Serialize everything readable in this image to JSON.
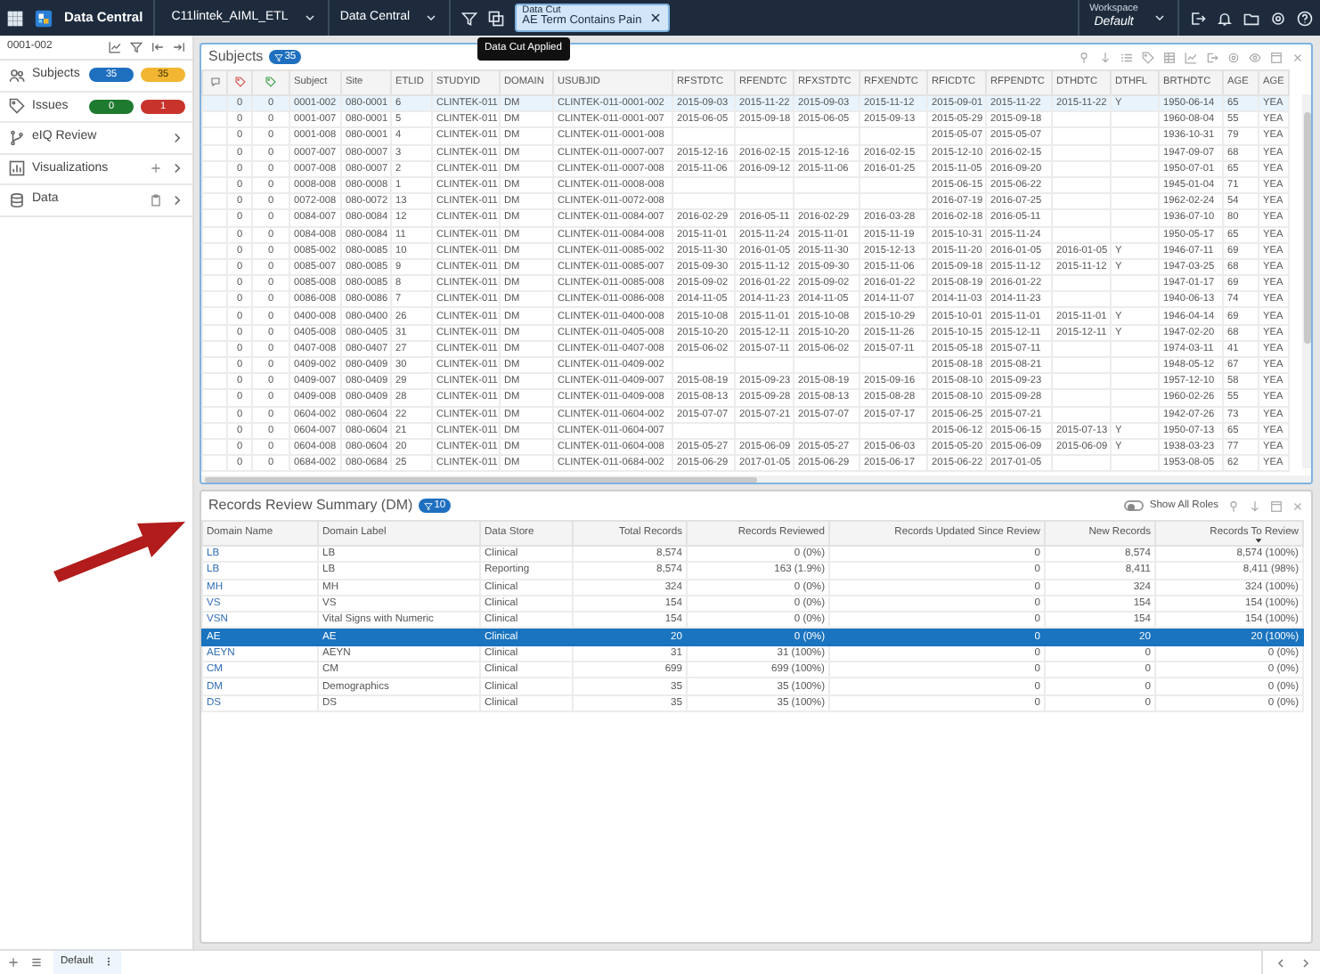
{
  "topbar": {
    "app_title": "Data Central",
    "study": "C11lintek_AIML_ETL",
    "view": "Data Central",
    "data_cut": {
      "label": "Data Cut",
      "value": "AE Term Contains Pain",
      "tooltip": "Data Cut Applied"
    },
    "workspace": {
      "label": "Workspace",
      "value": "Default"
    }
  },
  "sidebar": {
    "subject_id": "0001-002",
    "items": [
      {
        "kind": "counts",
        "label": "Subjects",
        "badges": [
          {
            "text": "35",
            "color": "#1f6fbf"
          },
          {
            "text": "35",
            "color": "#f2b632"
          }
        ]
      },
      {
        "kind": "counts",
        "label": "Issues",
        "badges": [
          {
            "text": "0",
            "color": "#1e7a2e"
          },
          {
            "text": "1",
            "color": "#c8342b"
          }
        ]
      },
      {
        "kind": "nav",
        "label": "eIQ Review"
      },
      {
        "kind": "add",
        "label": "Visualizations"
      },
      {
        "kind": "delete",
        "label": "Data"
      }
    ]
  },
  "subjects": {
    "title": "Subjects",
    "filter_count": "35",
    "columns": [
      {
        "kind": "icon"
      },
      {
        "kind": "icon"
      },
      {
        "kind": "icon"
      },
      {
        "kind": "text",
        "label": "Subject"
      },
      {
        "kind": "text",
        "label": "Site"
      },
      {
        "kind": "text",
        "label": "ETLID"
      },
      {
        "kind": "text",
        "label": "STUDYID"
      },
      {
        "kind": "text",
        "label": "DOMAIN"
      },
      {
        "kind": "text",
        "label": "USUBJID"
      },
      {
        "kind": "text",
        "label": "RFSTDTC"
      },
      {
        "kind": "text",
        "label": "RFENDTC"
      },
      {
        "kind": "text",
        "label": "RFXSTDTC"
      },
      {
        "kind": "text",
        "label": "RFXENDTC"
      },
      {
        "kind": "text",
        "label": "RFICDTC"
      },
      {
        "kind": "text",
        "label": "RFPENDTC"
      },
      {
        "kind": "text",
        "label": "DTHDTC"
      },
      {
        "kind": "text",
        "label": "DTHFL"
      },
      {
        "kind": "text",
        "label": "BRTHDTC"
      },
      {
        "kind": "text",
        "label": "AGE"
      },
      {
        "kind": "text",
        "label": "AGE"
      }
    ],
    "rows": [
      {
        "selected": true,
        "cells": [
          null,
          "0",
          "0",
          "0001-002",
          "080-0001",
          "6",
          "CLINTEK-011",
          "DM",
          "CLINTEK-011-0001-002",
          "2015-09-03",
          "2015-11-22",
          "2015-09-03",
          "2015-11-12",
          "2015-09-01",
          "2015-11-22",
          "2015-11-22",
          "Y",
          "1950-06-14",
          "65",
          "YEA"
        ]
      },
      {
        "selected": false,
        "cells": [
          null,
          "0",
          "0",
          "0001-007",
          "080-0001",
          "5",
          "CLINTEK-011",
          "DM",
          "CLINTEK-011-0001-007",
          "2015-06-05",
          "2015-09-18",
          "2015-06-05",
          "2015-09-13",
          "2015-05-29",
          "2015-09-18",
          null,
          null,
          "1960-08-04",
          "55",
          "YEA"
        ]
      },
      {
        "selected": false,
        "cells": [
          null,
          "0",
          "0",
          "0001-008",
          "080-0001",
          "4",
          "CLINTEK-011",
          "DM",
          "CLINTEK-011-0001-008",
          null,
          null,
          null,
          null,
          "2015-05-07",
          "2015-05-07",
          null,
          null,
          "1936-10-31",
          "79",
          "YEA"
        ]
      },
      {
        "selected": false,
        "cells": [
          null,
          "0",
          "0",
          "0007-007",
          "080-0007",
          "3",
          "CLINTEK-011",
          "DM",
          "CLINTEK-011-0007-007",
          "2015-12-16",
          "2016-02-15",
          "2015-12-16",
          "2016-02-15",
          "2015-12-10",
          "2016-02-15",
          null,
          null,
          "1947-09-07",
          "68",
          "YEA"
        ]
      },
      {
        "selected": false,
        "cells": [
          null,
          "0",
          "0",
          "0007-008",
          "080-0007",
          "2",
          "CLINTEK-011",
          "DM",
          "CLINTEK-011-0007-008",
          "2015-11-06",
          "2016-09-12",
          "2015-11-06",
          "2016-01-25",
          "2015-11-05",
          "2016-09-20",
          null,
          null,
          "1950-07-01",
          "65",
          "YEA"
        ]
      },
      {
        "selected": false,
        "cells": [
          null,
          "0",
          "0",
          "0008-008",
          "080-0008",
          "1",
          "CLINTEK-011",
          "DM",
          "CLINTEK-011-0008-008",
          null,
          null,
          null,
          null,
          "2015-06-15",
          "2015-06-22",
          null,
          null,
          "1945-01-04",
          "71",
          "YEA"
        ]
      },
      {
        "selected": false,
        "cells": [
          null,
          "0",
          "0",
          "0072-008",
          "080-0072",
          "13",
          "CLINTEK-011",
          "DM",
          "CLINTEK-011-0072-008",
          null,
          null,
          null,
          null,
          "2016-07-19",
          "2016-07-25",
          null,
          null,
          "1962-02-24",
          "54",
          "YEA"
        ]
      },
      {
        "selected": false,
        "cells": [
          null,
          "0",
          "0",
          "0084-007",
          "080-0084",
          "12",
          "CLINTEK-011",
          "DM",
          "CLINTEK-011-0084-007",
          "2016-02-29",
          "2016-05-11",
          "2016-02-29",
          "2016-03-28",
          "2016-02-18",
          "2016-05-11",
          null,
          null,
          "1936-07-10",
          "80",
          "YEA"
        ]
      },
      {
        "selected": false,
        "cells": [
          null,
          "0",
          "0",
          "0084-008",
          "080-0084",
          "11",
          "CLINTEK-011",
          "DM",
          "CLINTEK-011-0084-008",
          "2015-11-01",
          "2015-11-24",
          "2015-11-01",
          "2015-11-19",
          "2015-10-31",
          "2015-11-24",
          null,
          null,
          "1950-05-17",
          "65",
          "YEA"
        ]
      },
      {
        "selected": false,
        "cells": [
          null,
          "0",
          "0",
          "0085-002",
          "080-0085",
          "10",
          "CLINTEK-011",
          "DM",
          "CLINTEK-011-0085-002",
          "2015-11-30",
          "2016-01-05",
          "2015-11-30",
          "2015-12-13",
          "2015-11-20",
          "2016-01-05",
          "2016-01-05",
          "Y",
          "1946-07-11",
          "69",
          "YEA"
        ]
      },
      {
        "selected": false,
        "cells": [
          null,
          "0",
          "0",
          "0085-007",
          "080-0085",
          "9",
          "CLINTEK-011",
          "DM",
          "CLINTEK-011-0085-007",
          "2015-09-30",
          "2015-11-12",
          "2015-09-30",
          "2015-11-06",
          "2015-09-18",
          "2015-11-12",
          "2015-11-12",
          "Y",
          "1947-03-25",
          "68",
          "YEA"
        ]
      },
      {
        "selected": false,
        "cells": [
          null,
          "0",
          "0",
          "0085-008",
          "080-0085",
          "8",
          "CLINTEK-011",
          "DM",
          "CLINTEK-011-0085-008",
          "2015-09-02",
          "2016-01-22",
          "2015-09-02",
          "2016-01-22",
          "2015-08-19",
          "2016-01-22",
          null,
          null,
          "1947-01-17",
          "69",
          "YEA"
        ]
      },
      {
        "selected": false,
        "cells": [
          null,
          "0",
          "0",
          "0086-008",
          "080-0086",
          "7",
          "CLINTEK-011",
          "DM",
          "CLINTEK-011-0086-008",
          "2014-11-05",
          "2014-11-23",
          "2014-11-05",
          "2014-11-07",
          "2014-11-03",
          "2014-11-23",
          null,
          null,
          "1940-06-13",
          "74",
          "YEA"
        ]
      },
      {
        "selected": false,
        "cells": [
          null,
          "0",
          "0",
          "0400-008",
          "080-0400",
          "26",
          "CLINTEK-011",
          "DM",
          "CLINTEK-011-0400-008",
          "2015-10-08",
          "2015-11-01",
          "2015-10-08",
          "2015-10-29",
          "2015-10-01",
          "2015-11-01",
          "2015-11-01",
          "Y",
          "1946-04-14",
          "69",
          "YEA"
        ]
      },
      {
        "selected": false,
        "cells": [
          null,
          "0",
          "0",
          "0405-008",
          "080-0405",
          "31",
          "CLINTEK-011",
          "DM",
          "CLINTEK-011-0405-008",
          "2015-10-20",
          "2015-12-11",
          "2015-10-20",
          "2015-11-26",
          "2015-10-15",
          "2015-12-11",
          "2015-12-11",
          "Y",
          "1947-02-20",
          "68",
          "YEA"
        ]
      },
      {
        "selected": false,
        "cells": [
          null,
          "0",
          "0",
          "0407-008",
          "080-0407",
          "27",
          "CLINTEK-011",
          "DM",
          "CLINTEK-011-0407-008",
          "2015-06-02",
          "2015-07-11",
          "2015-06-02",
          "2015-07-11",
          "2015-05-18",
          "2015-07-11",
          null,
          null,
          "1974-03-11",
          "41",
          "YEA"
        ]
      },
      {
        "selected": false,
        "cells": [
          null,
          "0",
          "0",
          "0409-002",
          "080-0409",
          "30",
          "CLINTEK-011",
          "DM",
          "CLINTEK-011-0409-002",
          null,
          null,
          null,
          null,
          "2015-08-18",
          "2015-08-21",
          null,
          null,
          "1948-05-12",
          "67",
          "YEA"
        ]
      },
      {
        "selected": false,
        "cells": [
          null,
          "0",
          "0",
          "0409-007",
          "080-0409",
          "29",
          "CLINTEK-011",
          "DM",
          "CLINTEK-011-0409-007",
          "2015-08-19",
          "2015-09-23",
          "2015-08-19",
          "2015-09-16",
          "2015-08-10",
          "2015-09-23",
          null,
          null,
          "1957-12-10",
          "58",
          "YEA"
        ]
      },
      {
        "selected": false,
        "cells": [
          null,
          "0",
          "0",
          "0409-008",
          "080-0409",
          "28",
          "CLINTEK-011",
          "DM",
          "CLINTEK-011-0409-008",
          "2015-08-13",
          "2015-09-28",
          "2015-08-13",
          "2015-08-28",
          "2015-08-10",
          "2015-09-28",
          null,
          null,
          "1960-02-26",
          "55",
          "YEA"
        ]
      },
      {
        "selected": false,
        "cells": [
          null,
          "0",
          "0",
          "0604-002",
          "080-0604",
          "22",
          "CLINTEK-011",
          "DM",
          "CLINTEK-011-0604-002",
          "2015-07-07",
          "2015-07-21",
          "2015-07-07",
          "2015-07-17",
          "2015-06-25",
          "2015-07-21",
          null,
          null,
          "1942-07-26",
          "73",
          "YEA"
        ]
      },
      {
        "selected": false,
        "cells": [
          null,
          "0",
          "0",
          "0604-007",
          "080-0604",
          "21",
          "CLINTEK-011",
          "DM",
          "CLINTEK-011-0604-007",
          null,
          null,
          null,
          null,
          "2015-06-12",
          "2015-06-15",
          "2015-07-13",
          "Y",
          "1950-07-13",
          "65",
          "YEA"
        ]
      },
      {
        "selected": false,
        "cells": [
          null,
          "0",
          "0",
          "0604-008",
          "080-0604",
          "20",
          "CLINTEK-011",
          "DM",
          "CLINTEK-011-0604-008",
          "2015-05-27",
          "2015-06-09",
          "2015-05-27",
          "2015-06-03",
          "2015-05-20",
          "2015-06-09",
          "2015-06-09",
          "Y",
          "1938-03-23",
          "77",
          "YEA"
        ]
      },
      {
        "selected": false,
        "cells": [
          null,
          "0",
          "0",
          "0684-002",
          "080-0684",
          "25",
          "CLINTEK-011",
          "DM",
          "CLINTEK-011-0684-002",
          "2015-06-29",
          "2017-01-05",
          "2015-06-29",
          "2015-06-17",
          "2015-06-22",
          "2017-01-05",
          null,
          null,
          "1953-08-05",
          "62",
          "YEA"
        ]
      }
    ]
  },
  "review_summary": {
    "title": "Records Review Summary (DM)",
    "filter_count": "10",
    "show_all_roles": {
      "label": "Show All Roles",
      "on": false
    },
    "columns": [
      {
        "label": "Domain Name"
      },
      {
        "label": "Domain Label"
      },
      {
        "label": "Data Store"
      },
      {
        "label": "Total Records"
      },
      {
        "label": "Records Reviewed"
      },
      {
        "label": "Records Updated Since Review"
      },
      {
        "label": "New Records"
      },
      {
        "label": "Records To Review",
        "sorted": true
      }
    ],
    "rows": [
      {
        "selected": false,
        "cells": [
          "LB",
          "LB",
          "Clinical",
          "8,574",
          "0 (0%)",
          "0",
          "8,574",
          "8,574 (100%)"
        ]
      },
      {
        "selected": false,
        "cells": [
          "LB",
          "LB",
          "Reporting",
          "8,574",
          "163 (1.9%)",
          "0",
          "8,411",
          "8,411 (98%)"
        ]
      },
      {
        "selected": false,
        "cells": [
          "MH",
          "MH",
          "Clinical",
          "324",
          "0 (0%)",
          "0",
          "324",
          "324 (100%)"
        ]
      },
      {
        "selected": false,
        "cells": [
          "VS",
          "VS",
          "Clinical",
          "154",
          "0 (0%)",
          "0",
          "154",
          "154 (100%)"
        ]
      },
      {
        "selected": false,
        "cells": [
          "VSN",
          "Vital Signs with Numeric",
          "Clinical",
          "154",
          "0 (0%)",
          "0",
          "154",
          "154 (100%)"
        ]
      },
      {
        "selected": true,
        "cells": [
          "AE",
          "AE",
          "Clinical",
          "20",
          "0 (0%)",
          "0",
          "20",
          "20 (100%)"
        ]
      },
      {
        "selected": false,
        "cells": [
          "AEYN",
          "AEYN",
          "Clinical",
          "31",
          "31 (100%)",
          "0",
          "0",
          "0 (0%)"
        ]
      },
      {
        "selected": false,
        "cells": [
          "CM",
          "CM",
          "Clinical",
          "699",
          "699 (100%)",
          "0",
          "0",
          "0 (0%)"
        ]
      },
      {
        "selected": false,
        "cells": [
          "DM",
          "Demographics",
          "Clinical",
          "35",
          "35 (100%)",
          "0",
          "0",
          "0 (0%)"
        ]
      },
      {
        "selected": false,
        "cells": [
          "DS",
          "DS",
          "Clinical",
          "35",
          "35 (100%)",
          "0",
          "0",
          "0 (0%)"
        ]
      }
    ]
  },
  "bottom_tabs": [
    {
      "label": "Default",
      "selected": true
    }
  ]
}
